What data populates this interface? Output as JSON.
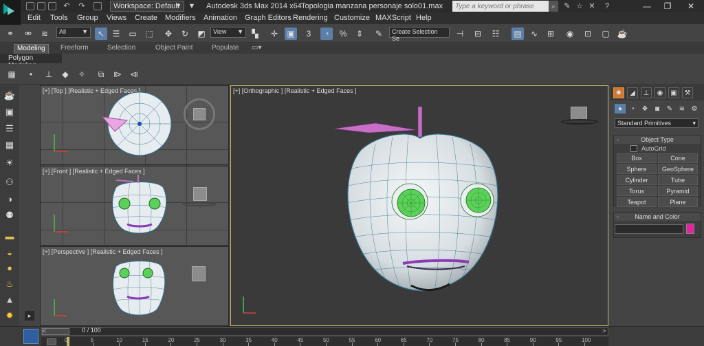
{
  "title_bar": {
    "workspace": "Workspace: Default",
    "app_name": "Autodesk 3ds Max  2014 x64",
    "file_name": "Topologia manzana personaje solo01.max",
    "search_placeholder": "Type a keyword or phrase"
  },
  "menu": [
    "Edit",
    "Tools",
    "Group",
    "Views",
    "Create",
    "Modifiers",
    "Animation",
    "Graph Editors",
    "Rendering",
    "Customize",
    "MAXScript",
    "Help"
  ],
  "toolbar": {
    "selection_filter": "All",
    "reference_coord": "View",
    "named_selection": "Create Selection Se",
    "snap_label": "3"
  },
  "ribbon": {
    "tabs": [
      "Modeling",
      "Freeform",
      "Selection",
      "Object Paint",
      "Populate"
    ],
    "active_tab": "Modeling",
    "panel_label": "Polygon Modeling"
  },
  "viewports": {
    "top": "[+] [Top ] [Realistic + Edged Faces ]",
    "front": "[+] [Front ] [Realistic + Edged Faces ]",
    "perspective": "[+] [Perspective ] [Realistic + Edged Faces ]",
    "ortho": "[+] [Orthographic ] [Realistic + Edged Faces ]"
  },
  "command_panel": {
    "category": "Standard Primitives",
    "object_type_title": "Object Type",
    "autogrid_label": "AutoGrid",
    "primitives": [
      "Box",
      "Cone",
      "Sphere",
      "GeoSphere",
      "Cylinder",
      "Tube",
      "Torus",
      "Pyramid",
      "Teapot",
      "Plane"
    ],
    "name_color_title": "Name and Color",
    "object_color": "#e2239a"
  },
  "timeline": {
    "frame_text": "0 / 100",
    "ticks": [
      "0",
      "5",
      "10",
      "15",
      "20",
      "25",
      "30",
      "35",
      "40",
      "45",
      "50",
      "55",
      "60",
      "65",
      "70",
      "75",
      "80",
      "85",
      "90",
      "95",
      "100"
    ]
  },
  "colors": {
    "apple_mesh": "#dfe6ea",
    "wire": "#2e6f8a",
    "eye": "#5bd15a",
    "leaf_stem": "#c070c0",
    "active_border": "#c7b76a"
  }
}
